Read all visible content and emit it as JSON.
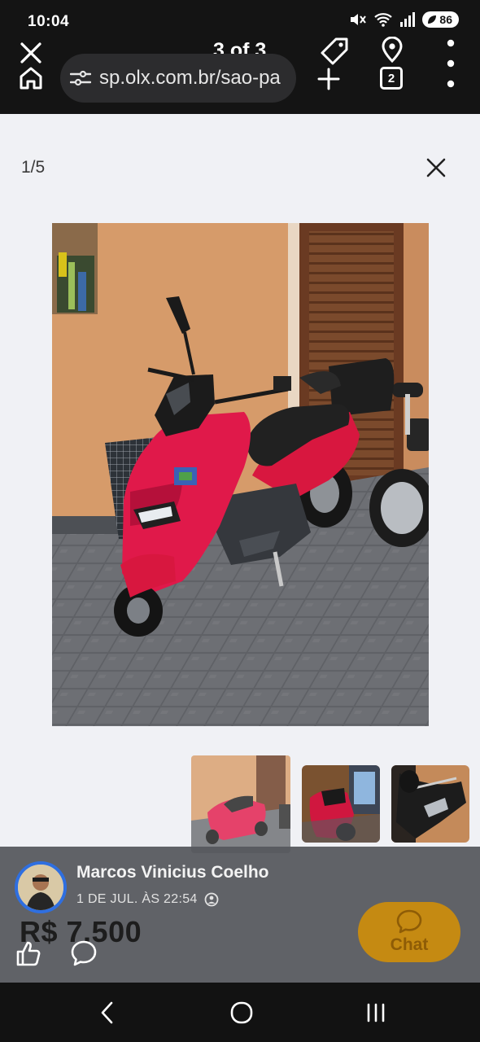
{
  "status_bar": {
    "time": "10:04",
    "battery": "86"
  },
  "browser": {
    "find_count": "3 of 3",
    "url": "sp.olx.com.br/sao-pa",
    "tab_count": "2"
  },
  "viewer": {
    "counter": "1/5"
  },
  "listing": {
    "seller_name": "Marcos Vinicius Coelho",
    "post_date": "1 DE JUL. ÀS 22:54",
    "price": "R$ 7.500",
    "chat_label": "Chat"
  },
  "icons": {
    "close": "close-icon",
    "home": "home-icon",
    "site_settings": "tune-icon",
    "tag": "tag-icon",
    "location": "location-pin-icon",
    "add": "plus-icon",
    "menu": "more-vert-icon",
    "like": "thumbs-up-icon",
    "comment": "comment-icon",
    "chat": "chat-bubble-icon"
  },
  "colors": {
    "scooter_red": "#e0194a",
    "wall": "#d69b6a",
    "chat_button": "#c58a12",
    "avatar_ring": "#2f6fe0"
  }
}
